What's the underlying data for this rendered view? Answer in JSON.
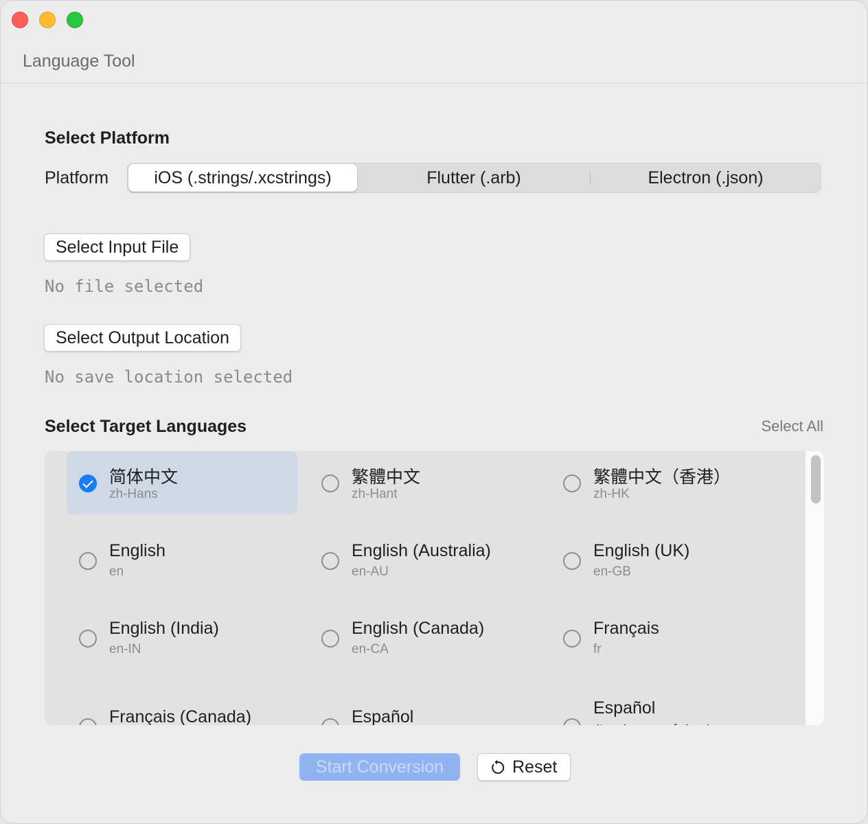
{
  "window": {
    "title": "Language Tool"
  },
  "platform_section": {
    "heading": "Select Platform",
    "label": "Platform",
    "options": [
      "iOS (.strings/.xcstrings)",
      "Flutter (.arb)",
      "Electron (.json)"
    ],
    "selected": "iOS (.strings/.xcstrings)"
  },
  "input_file": {
    "button": "Select Input File",
    "status": "No file selected"
  },
  "output": {
    "button": "Select Output Location",
    "status": "No save location selected"
  },
  "languages_section": {
    "heading": "Select Target Languages",
    "select_all": "Select All",
    "languages": [
      {
        "name": "简体中文",
        "code": "zh-Hans",
        "checked": true
      },
      {
        "name": "繁體中文",
        "code": "zh-Hant",
        "checked": false
      },
      {
        "name": "繁體中文（香港）",
        "code": "zh-HK",
        "checked": false
      },
      {
        "name": "English",
        "code": "en",
        "checked": false
      },
      {
        "name": "English (Australia)",
        "code": "en-AU",
        "checked": false
      },
      {
        "name": "English (UK)",
        "code": "en-GB",
        "checked": false
      },
      {
        "name": "English (India)",
        "code": "en-IN",
        "checked": false
      },
      {
        "name": "English (Canada)",
        "code": "en-CA",
        "checked": false
      },
      {
        "name": "Français",
        "code": "fr",
        "checked": false
      },
      {
        "name": "Français (Canada)",
        "code": "",
        "checked": false
      },
      {
        "name": "Español",
        "code": "",
        "checked": false
      },
      {
        "name": "Español (Latinoamérica)",
        "code": "",
        "checked": false
      }
    ]
  },
  "actions": {
    "start": "Start Conversion",
    "reset": "Reset"
  },
  "colors": {
    "accent": "#1a7cf5",
    "start_disabled_bg": "#8fb4f1",
    "selected_row_bg": "#cfd9e6"
  }
}
